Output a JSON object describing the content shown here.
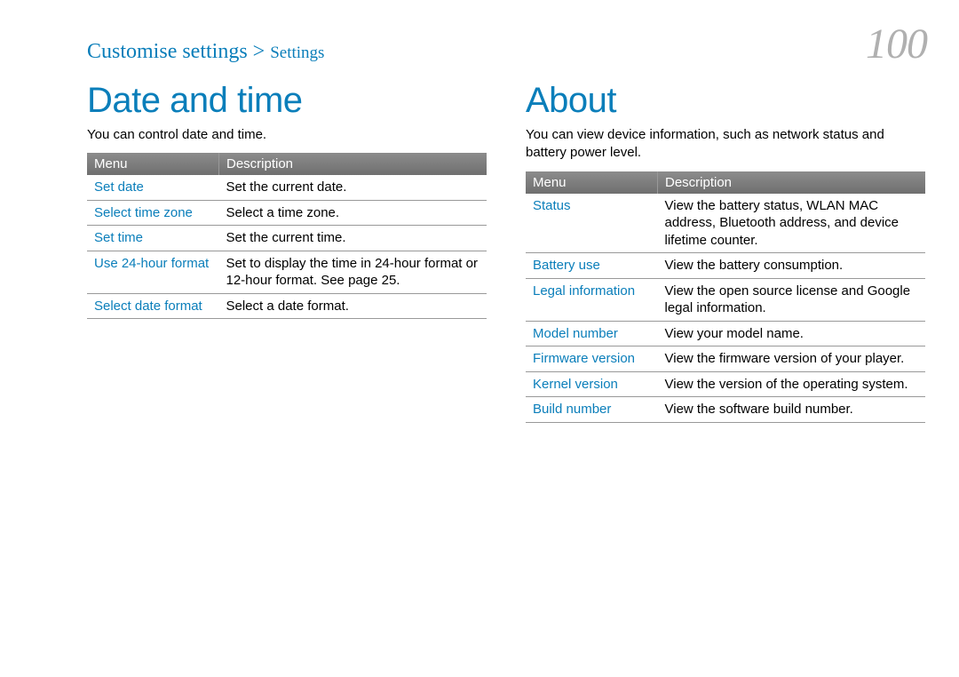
{
  "header": {
    "breadcrumb_main": "Customise settings >",
    "breadcrumb_sub": "Settings",
    "page_number": "100"
  },
  "left": {
    "title": "Date and time",
    "description": "You can control date and time.",
    "table": {
      "head_menu": "Menu",
      "head_desc": "Description",
      "rows": [
        {
          "menu": "Set date",
          "desc": "Set the current date."
        },
        {
          "menu": "Select time zone",
          "desc": "Select a time zone."
        },
        {
          "menu": "Set time",
          "desc": "Set the current time."
        },
        {
          "menu": "Use 24-hour format",
          "desc": "Set to display the time in 24-hour format or 12-hour format. See page 25."
        },
        {
          "menu": "Select date format",
          "desc": "Select a date format."
        }
      ]
    }
  },
  "right": {
    "title": "About",
    "description": "You can view device information, such as network status and battery power level.",
    "table": {
      "head_menu": "Menu",
      "head_desc": "Description",
      "rows": [
        {
          "menu": "Status",
          "desc": "View the battery status, WLAN MAC address, Bluetooth address, and device lifetime counter."
        },
        {
          "menu": "Battery use",
          "desc": "View the battery consumption."
        },
        {
          "menu": "Legal information",
          "desc": "View the open source license and Google legal information."
        },
        {
          "menu": "Model number",
          "desc": "View your model name."
        },
        {
          "menu": "Firmware version",
          "desc": "View the firmware version of your player."
        },
        {
          "menu": "Kernel version",
          "desc": "View the version of the operating system."
        },
        {
          "menu": "Build number",
          "desc": "View the software build number."
        }
      ]
    }
  }
}
